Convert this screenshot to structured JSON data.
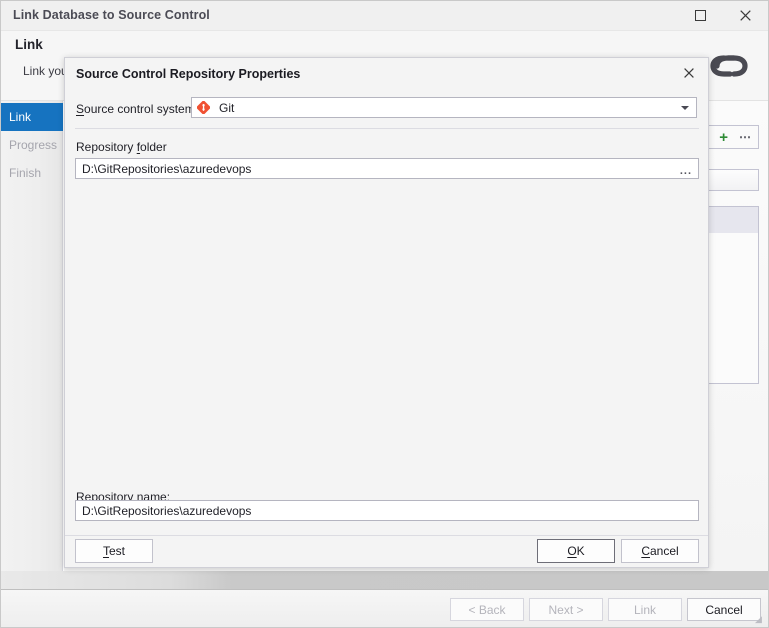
{
  "window": {
    "title": "Link Database to Source Control",
    "caption_buttons": [
      {
        "name": "maximize",
        "label": "Maximize"
      },
      {
        "name": "close",
        "label": "Close"
      }
    ]
  },
  "header": {
    "title": "Link",
    "subtitle": "Link your",
    "icon": "chain-link-icon"
  },
  "sidebar": {
    "items": [
      {
        "label": "Link",
        "state": "active"
      },
      {
        "label": "Progress",
        "state": "disabled"
      },
      {
        "label": "Finish",
        "state": "disabled"
      }
    ]
  },
  "background_panel": {
    "toolbar_icons": [
      "chevron-down-icon",
      "plus-icon",
      "ellipsis-icon"
    ]
  },
  "footer": {
    "buttons": [
      {
        "label": "< Back",
        "enabled": false
      },
      {
        "label": "Next >",
        "enabled": false
      },
      {
        "label": "Link",
        "enabled": false
      },
      {
        "label": "Cancel",
        "enabled": true
      }
    ]
  },
  "dialog": {
    "title": "Source Control Repository Properties",
    "close_label": "Close",
    "source_control_system": {
      "label": "Source control system:",
      "label_accesskey": "S",
      "value": "Git",
      "icon": "git-icon",
      "options": [
        "Git"
      ]
    },
    "repository_folder": {
      "label": "Repository folder",
      "label_accesskey": "f",
      "value": "D:\\GitRepositories\\azuredevops",
      "placeholder": "",
      "browse_label": "..."
    },
    "repository_name": {
      "label": "Repository name:",
      "label_accesskey": "n",
      "value": "D:\\GitRepositories\\azuredevops",
      "placeholder": ""
    },
    "buttons": {
      "test": "Test",
      "ok": "OK",
      "cancel": "Cancel"
    }
  },
  "colors": {
    "accent_selected": "#1673c0",
    "git_orange": "#f05133",
    "plus_green": "#2e8b35",
    "dialog_bg": "#f4f4f4",
    "window_bg": "#f6f6f6"
  }
}
